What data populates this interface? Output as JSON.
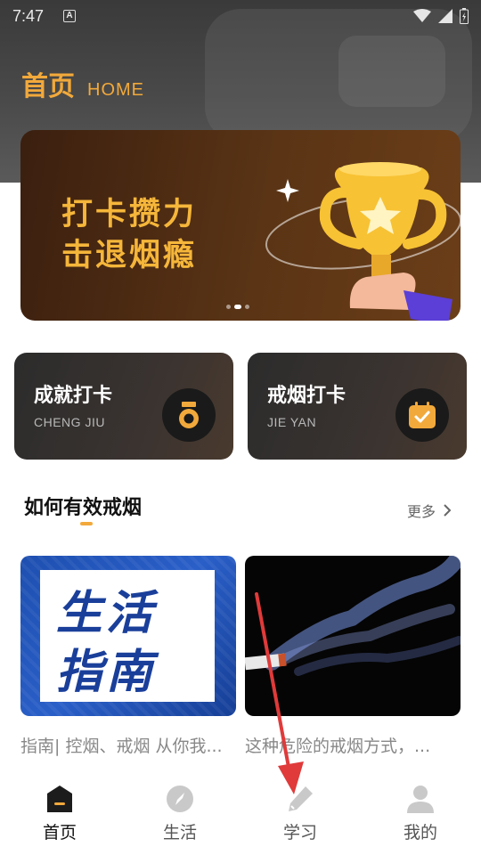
{
  "status_bar": {
    "time": "7:47",
    "notification_letter": "A"
  },
  "header": {
    "title_cn": "首页",
    "title_en": "HOME"
  },
  "banner": {
    "line1": "打卡攒力",
    "line2": "击退烟瘾",
    "page_count": 3,
    "active_page": 2
  },
  "cards": [
    {
      "title": "成就打卡",
      "subtitle": "CHENG JIU",
      "icon": "medal-icon"
    },
    {
      "title": "戒烟打卡",
      "subtitle": "JIE YAN",
      "icon": "calendar-check-icon"
    }
  ],
  "section": {
    "title": "如何有效戒烟",
    "more_label": "更多"
  },
  "articles": [
    {
      "image_text_line1": "生活",
      "image_text_line2": "指南",
      "caption": "指南| 控烟、戒烟 从你我..."
    },
    {
      "caption": "这种危险的戒烟方式，..."
    }
  ],
  "tabbar": {
    "items": [
      {
        "label": "首页",
        "icon": "home-icon",
        "active": true
      },
      {
        "label": "生活",
        "icon": "compass-icon",
        "active": false
      },
      {
        "label": "学习",
        "icon": "pencil-icon",
        "active": false
      },
      {
        "label": "我的",
        "icon": "profile-icon",
        "active": false
      }
    ]
  },
  "colors": {
    "accent": "#f2a93b",
    "banner_bg": "#4a2a12",
    "card_bg": "#2f2f2f",
    "annotation_arrow": "#e03a3a"
  }
}
